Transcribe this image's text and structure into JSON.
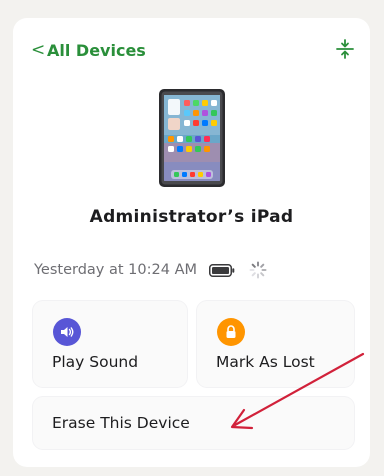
{
  "header": {
    "back_chevron": "<",
    "back_label": "All Devices",
    "collapse_icon": "collapse-icon"
  },
  "device": {
    "name": "Administrator’s iPad",
    "image": "ipad-icon",
    "last_seen": "Yesterday at 10:24 AM",
    "battery_icon": "battery-icon",
    "status_icon": "loading-spinner-icon"
  },
  "actions": {
    "play_sound": {
      "label": "Play Sound",
      "icon": "speaker-icon",
      "icon_color": "#5856d6"
    },
    "mark_as_lost": {
      "label": "Mark As Lost",
      "icon": "lock-icon",
      "icon_color": "#ff9500"
    },
    "erase": {
      "label": "Erase This Device"
    }
  },
  "colors": {
    "accent": "#2a8f3a",
    "annotation_arrow": "#d1213a"
  }
}
